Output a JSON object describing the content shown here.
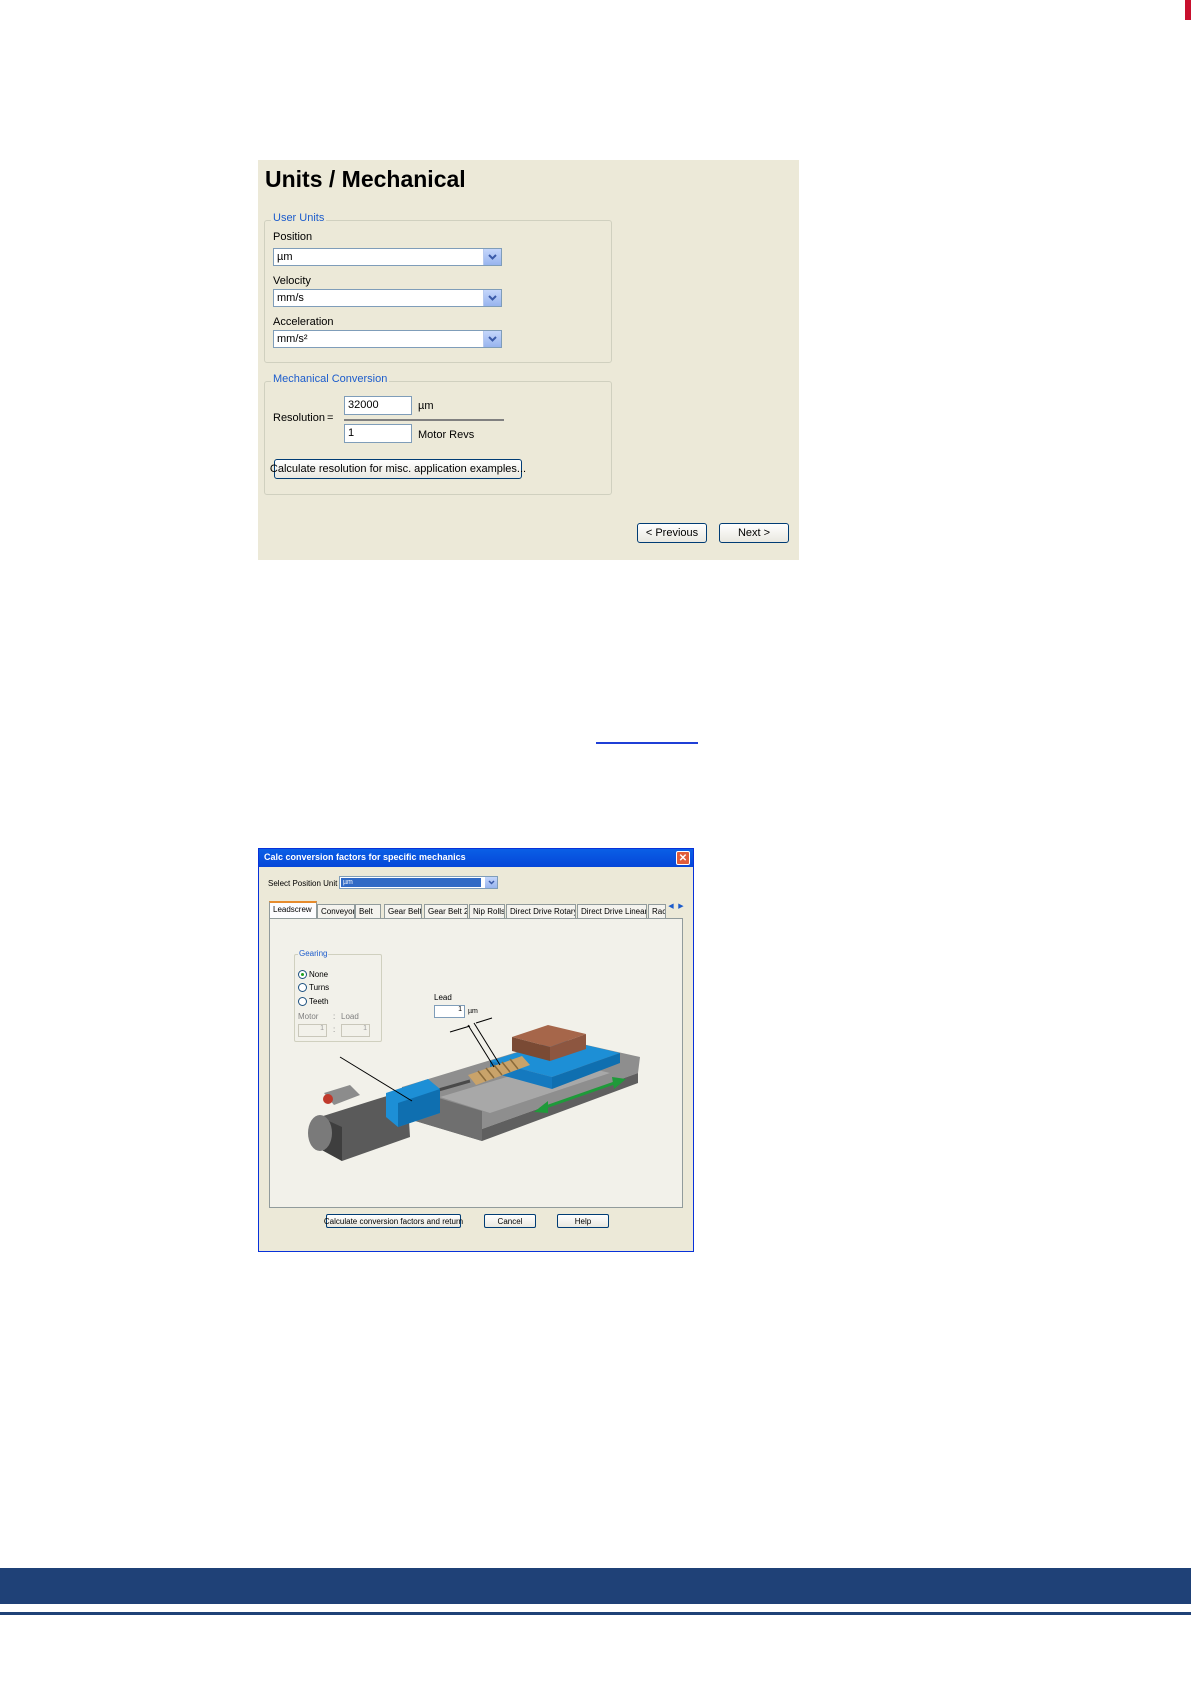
{
  "wizard": {
    "title": "Units / Mechanical",
    "user_units": {
      "legend": "User Units",
      "position_label": "Position",
      "position_value": "µm",
      "velocity_label": "Velocity",
      "velocity_value": "mm/s",
      "acceleration_label": "Acceleration",
      "acceleration_value": "mm/s²"
    },
    "mechanical_conversion": {
      "legend": "Mechanical Conversion",
      "resolution_label": "Resolution",
      "equals": "=",
      "numerator_value": "32000",
      "numerator_unit": "µm",
      "denominator_value": "1",
      "denominator_unit": "Motor Revs",
      "calc_button": "Calculate resolution for misc. application examples..."
    },
    "previous_button": "< Previous",
    "next_button": "Next >"
  },
  "dialog": {
    "title": "Calc conversion factors for specific mechanics",
    "select_unit_label": "Select Position Unit",
    "select_unit_value": "µm",
    "tabs": [
      "Leadscrew",
      "Conveyor",
      "Belt",
      "Gear Belt",
      "Gear Belt 2",
      "Nip Rolls",
      "Direct Drive Rotary",
      "Direct Drive Linear",
      "Rack"
    ],
    "gearing": {
      "legend": "Gearing",
      "options": [
        "None",
        "Turns",
        "Teeth"
      ],
      "selected": "None",
      "motor_label": "Motor",
      "colon": ":",
      "load_label": "Load",
      "motor_value": "1",
      "load_value": "1"
    },
    "lead_label": "Lead",
    "lead_value": "1",
    "lead_unit": "µm",
    "calc_button": "Calculate conversion factors and return",
    "cancel_button": "Cancel",
    "help_button": "Help"
  },
  "colors": {
    "panel": "#ece9d8",
    "group_label": "#1c5ccc",
    "title_bar": "#0a5fe6",
    "footer": "#1f4177",
    "accent_red": "#c8102e"
  }
}
